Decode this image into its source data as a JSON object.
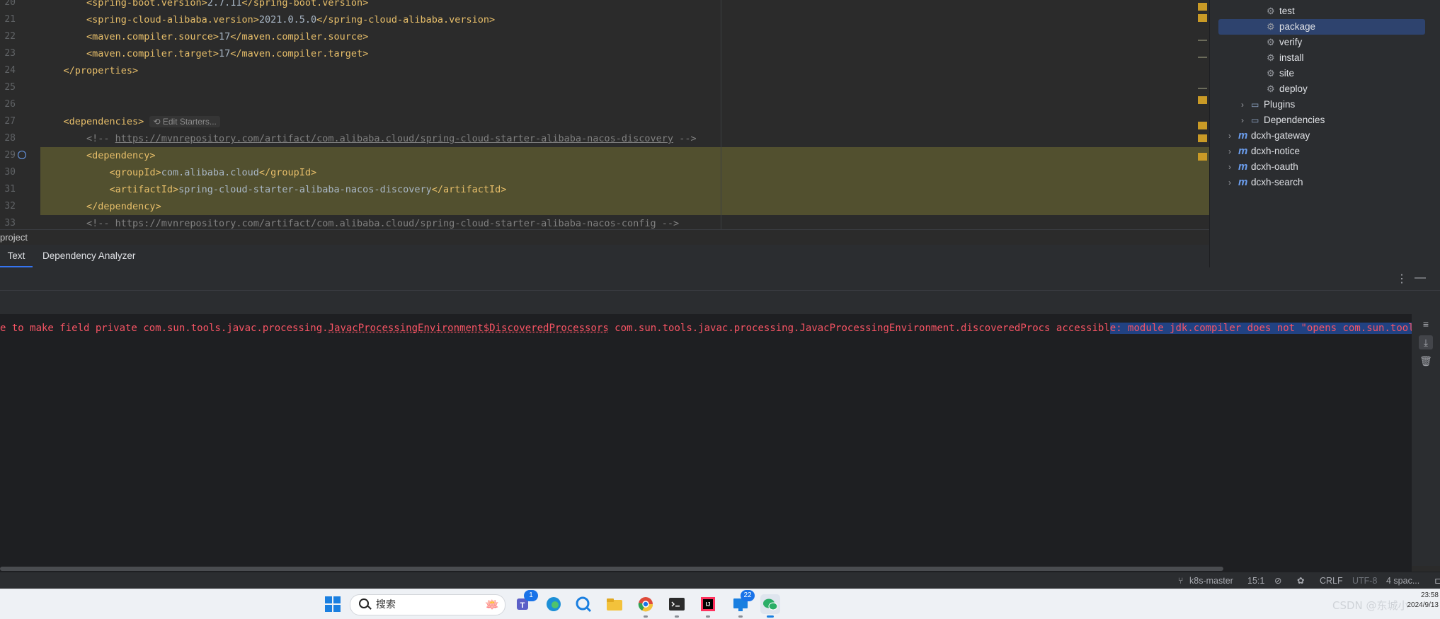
{
  "editor": {
    "lines": [
      {
        "num": "20",
        "pre": "        ",
        "open": "<spring-boot.version>",
        "text": "2.7.11",
        "close": "</spring-boot.version>"
      },
      {
        "num": "21",
        "pre": "        ",
        "open": "<spring-cloud-alibaba.version>",
        "text": "2021.0.5.0",
        "close": "</spring-cloud-alibaba.version>"
      },
      {
        "num": "22",
        "pre": "        ",
        "open": "<maven.compiler.source>",
        "text": "17",
        "close": "</maven.compiler.source>"
      },
      {
        "num": "23",
        "pre": "        ",
        "open": "<maven.compiler.target>",
        "text": "17",
        "close": "</maven.compiler.target>"
      },
      {
        "num": "24",
        "pre": "    ",
        "open": "</properties>",
        "text": "",
        "close": ""
      },
      {
        "num": "25",
        "pre": "",
        "open": "",
        "text": "",
        "close": ""
      },
      {
        "num": "26",
        "pre": "",
        "open": "",
        "text": "",
        "close": ""
      },
      {
        "num": "27",
        "pre": "    ",
        "open": "<dependencies>",
        "text": "",
        "close": ""
      },
      {
        "num": "28",
        "pre": "        ",
        "open": "",
        "text": "",
        "close": ""
      },
      {
        "num": "29",
        "pre": "        ",
        "open": "<dependency>",
        "text": "",
        "close": ""
      },
      {
        "num": "30",
        "pre": "            ",
        "open": "<groupId>",
        "text": "com.alibaba.cloud",
        "close": "</groupId>"
      },
      {
        "num": "31",
        "pre": "            ",
        "open": "<artifactId>",
        "text": "spring-cloud-starter-alibaba-nacos-discovery",
        "close": "</artifactId>"
      },
      {
        "num": "32",
        "pre": "        ",
        "open": "</dependency>",
        "text": "",
        "close": ""
      },
      {
        "num": "33",
        "pre": "        ",
        "open": "",
        "text": "",
        "close": ""
      }
    ],
    "edit_starters_hint": "Edit Starters...",
    "comment_28_prefix": "<!-- ",
    "comment_28_url": "https://mvnrepository.com/artifact/com.alibaba.cloud/spring-cloud-starter-alibaba-nacos-discovery",
    "comment_28_suffix": " -->",
    "comment_33": "<!-- https://mvnrepository.com/artifact/com.alibaba.cloud/spring-cloud-starter-alibaba-nacos-config -->"
  },
  "maven": {
    "lifecycle": [
      {
        "label": "test",
        "selected": false
      },
      {
        "label": "package",
        "selected": true
      },
      {
        "label": "verify",
        "selected": false
      },
      {
        "label": "install",
        "selected": false
      },
      {
        "label": "site",
        "selected": false
      },
      {
        "label": "deploy",
        "selected": false
      }
    ],
    "folders": [
      {
        "label": "Plugins"
      },
      {
        "label": "Dependencies"
      }
    ],
    "modules": [
      {
        "label": "dcxh-gateway"
      },
      {
        "label": "dcxh-notice"
      },
      {
        "label": "dcxh-oauth"
      },
      {
        "label": "dcxh-search"
      }
    ]
  },
  "breadcrumb": "project",
  "tabs": [
    {
      "label": "Text",
      "active": true
    },
    {
      "label": "Dependency Analyzer",
      "active": false
    }
  ],
  "console": {
    "err_a": "e to make field private com.sun.tools.javac.processing.",
    "err_b": "JavacProcessingEnvironment$DiscoveredProcessors",
    "err_c": " com.sun.tools.javac.processing.JavacProcessingEnvironment.discoveredProcs accessibl",
    "err_sel": "e: module jdk.compiler does not \"opens com.sun.tools.javac.proce"
  },
  "status": {
    "branch": "k8s-master",
    "position": "15:1",
    "line_ending": "CRLF",
    "encoding": "UTF-8",
    "indent": "4 spac..."
  },
  "taskbar": {
    "search_placeholder": "搜索",
    "teams_badge": "1",
    "remote_badge": "22",
    "watermark": "CSDN @东城小",
    "clock_time": "23:58",
    "clock_date": "2024/9/13"
  },
  "colors": {
    "accent": "#3574f0",
    "error": "#f75464",
    "tag": "#e8bf6a",
    "highlight": "#52502f",
    "selection": "#214283"
  }
}
